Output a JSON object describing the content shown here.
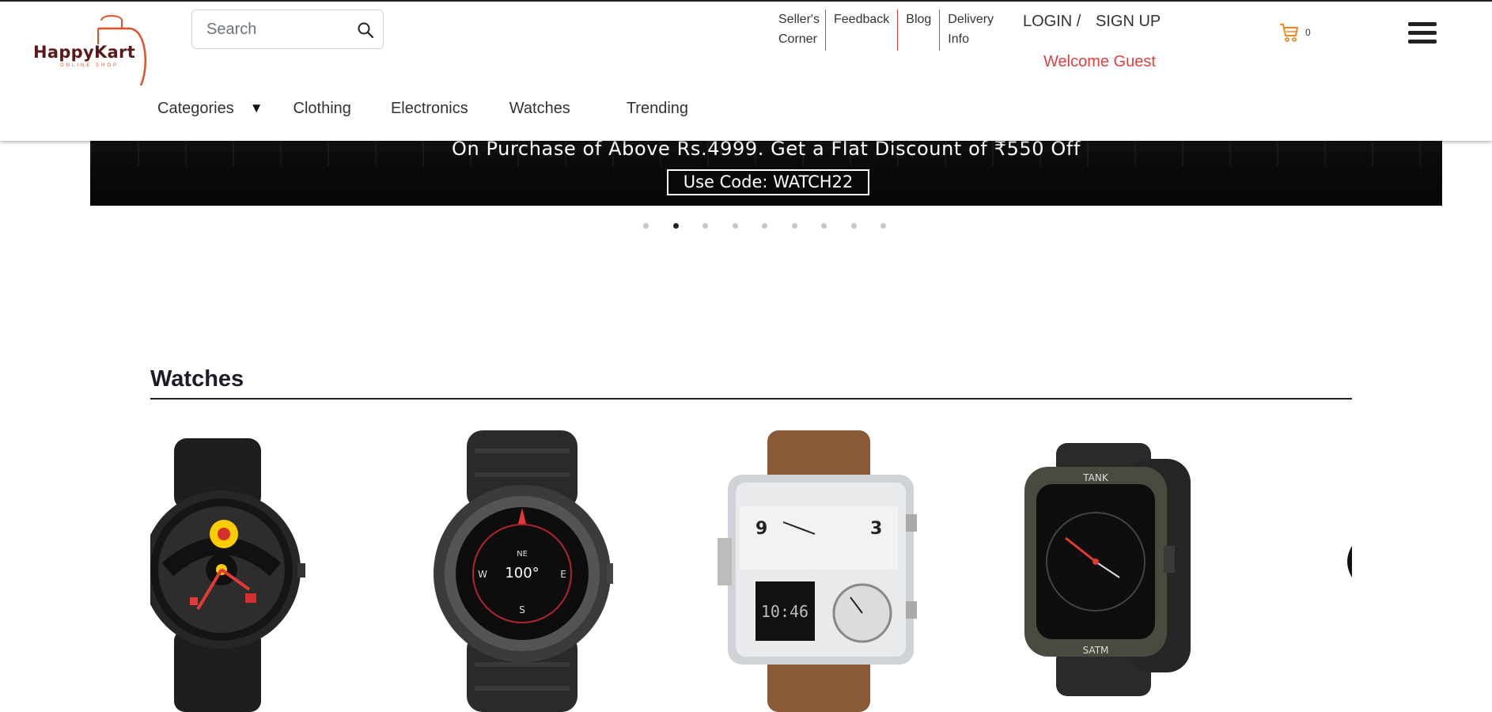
{
  "brand": {
    "name": "HappyKart",
    "tagline": "ONLINE SHOP"
  },
  "search": {
    "placeholder": "Search"
  },
  "top_links": [
    {
      "label": "Seller's Corner"
    },
    {
      "label": "Feedback"
    },
    {
      "label": "Blog"
    },
    {
      "label": "Delivery Info"
    }
  ],
  "auth": {
    "login": "LOGIN /",
    "signup": "SIGN UP",
    "welcome": "Welcome Guest"
  },
  "cart": {
    "count": "0"
  },
  "category_nav": {
    "categories": "Categories",
    "arrow": "▼",
    "items": [
      "Clothing",
      "Electronics",
      "Watches",
      "Trending"
    ]
  },
  "banner": {
    "headline": "On Purchase of Above Rs.4999. Get a Flat Discount of ₹550 Off",
    "code": "Use Code: WATCH22"
  },
  "carousel": {
    "slides": 9,
    "active_index": 1
  },
  "section": {
    "title": "Watches",
    "products": [
      {
        "icon": "sports-steering-wheel-watch"
      },
      {
        "icon": "compass-dial-smartwatch"
      },
      {
        "icon": "skmei-rectangular-multi-dial-watch"
      },
      {
        "icon": "tank-rugged-smartwatch"
      }
    ]
  },
  "colors": {
    "accent_red": "#e23e3e",
    "cart_orange": "#e8891e",
    "logo_maroon": "#5a1a1a"
  }
}
